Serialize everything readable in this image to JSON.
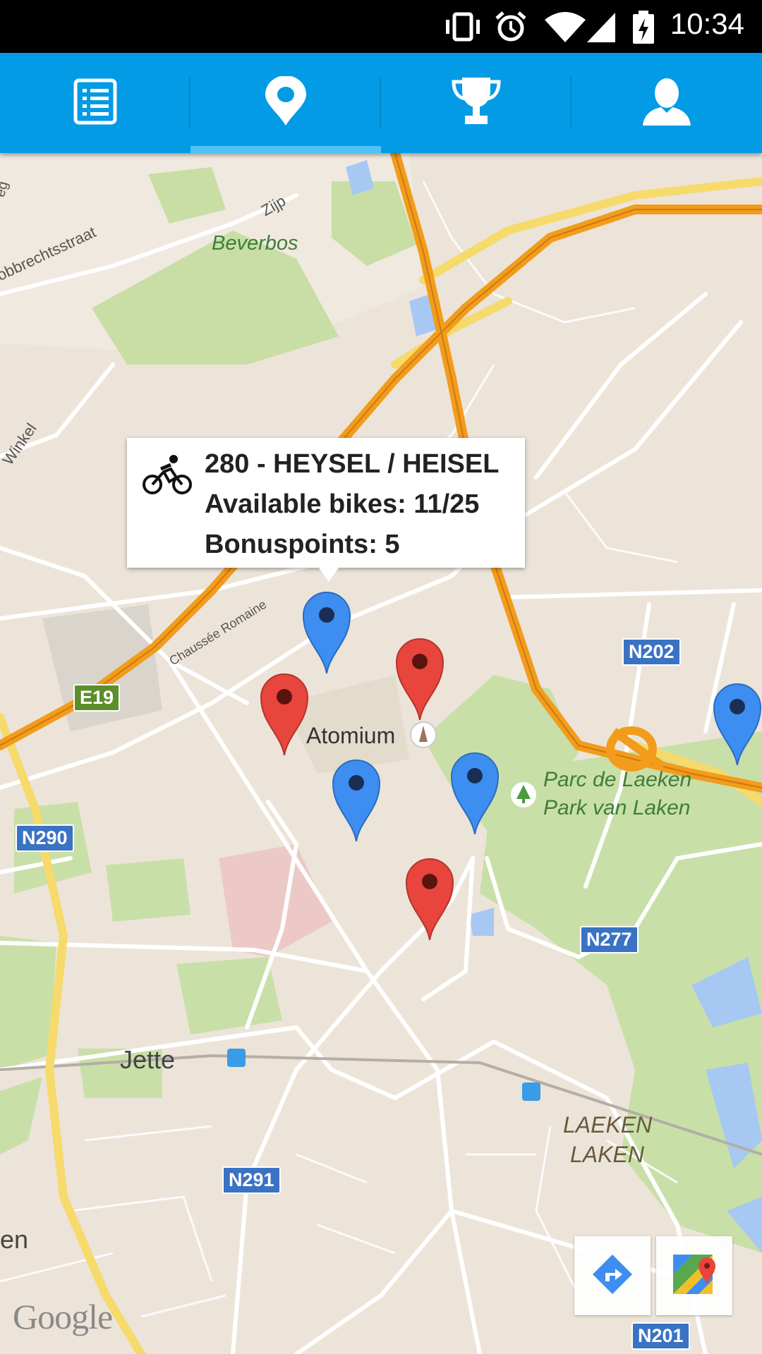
{
  "status_bar": {
    "time": "10:34",
    "icons": [
      "vibrate-icon",
      "alarm-icon",
      "wifi-icon",
      "cell-signal-icon",
      "battery-charging-icon"
    ]
  },
  "tabs": [
    {
      "name": "list",
      "icon": "list-icon"
    },
    {
      "name": "map",
      "icon": "map-pin-icon",
      "selected": true
    },
    {
      "name": "ranking",
      "icon": "trophy-icon"
    },
    {
      "name": "profile",
      "icon": "person-icon"
    }
  ],
  "info_window": {
    "icon": "bicycle-icon",
    "station": "280 - HEYSEL / HEISEL",
    "bikes": "Available bikes: 11/25",
    "bonus": "Bonuspoints: 5"
  },
  "map": {
    "labels": {
      "beverbos": "Beverbos",
      "zijp": "Zijp",
      "obbrechtsstraat": "obbrechtsstraat",
      "winkel": "Winkel",
      "chaussee": "Chaussée Romaine",
      "atomium": "Atomium",
      "parc1": "Parc de Laeken",
      "parc2": "Park van Laken",
      "jette": "Jette",
      "laeken1": "LAEKEN",
      "laeken2": "LAKEN",
      "en": "en",
      "eg": "eg"
    },
    "road_shields": {
      "e19": "E19",
      "n290": "N290",
      "n202": "N202",
      "n277": "N277",
      "n291": "N291",
      "n201": "N201"
    },
    "attribution": "Google",
    "colors": {
      "blue_pin": "#3d8ef0",
      "red_pin": "#e8453c",
      "highway": "#f39c1b",
      "park": "#c9dfa8",
      "water": "#a7c8f2"
    }
  },
  "map_buttons": {
    "directions": "directions-icon",
    "open_maps": "google-maps-icon"
  }
}
